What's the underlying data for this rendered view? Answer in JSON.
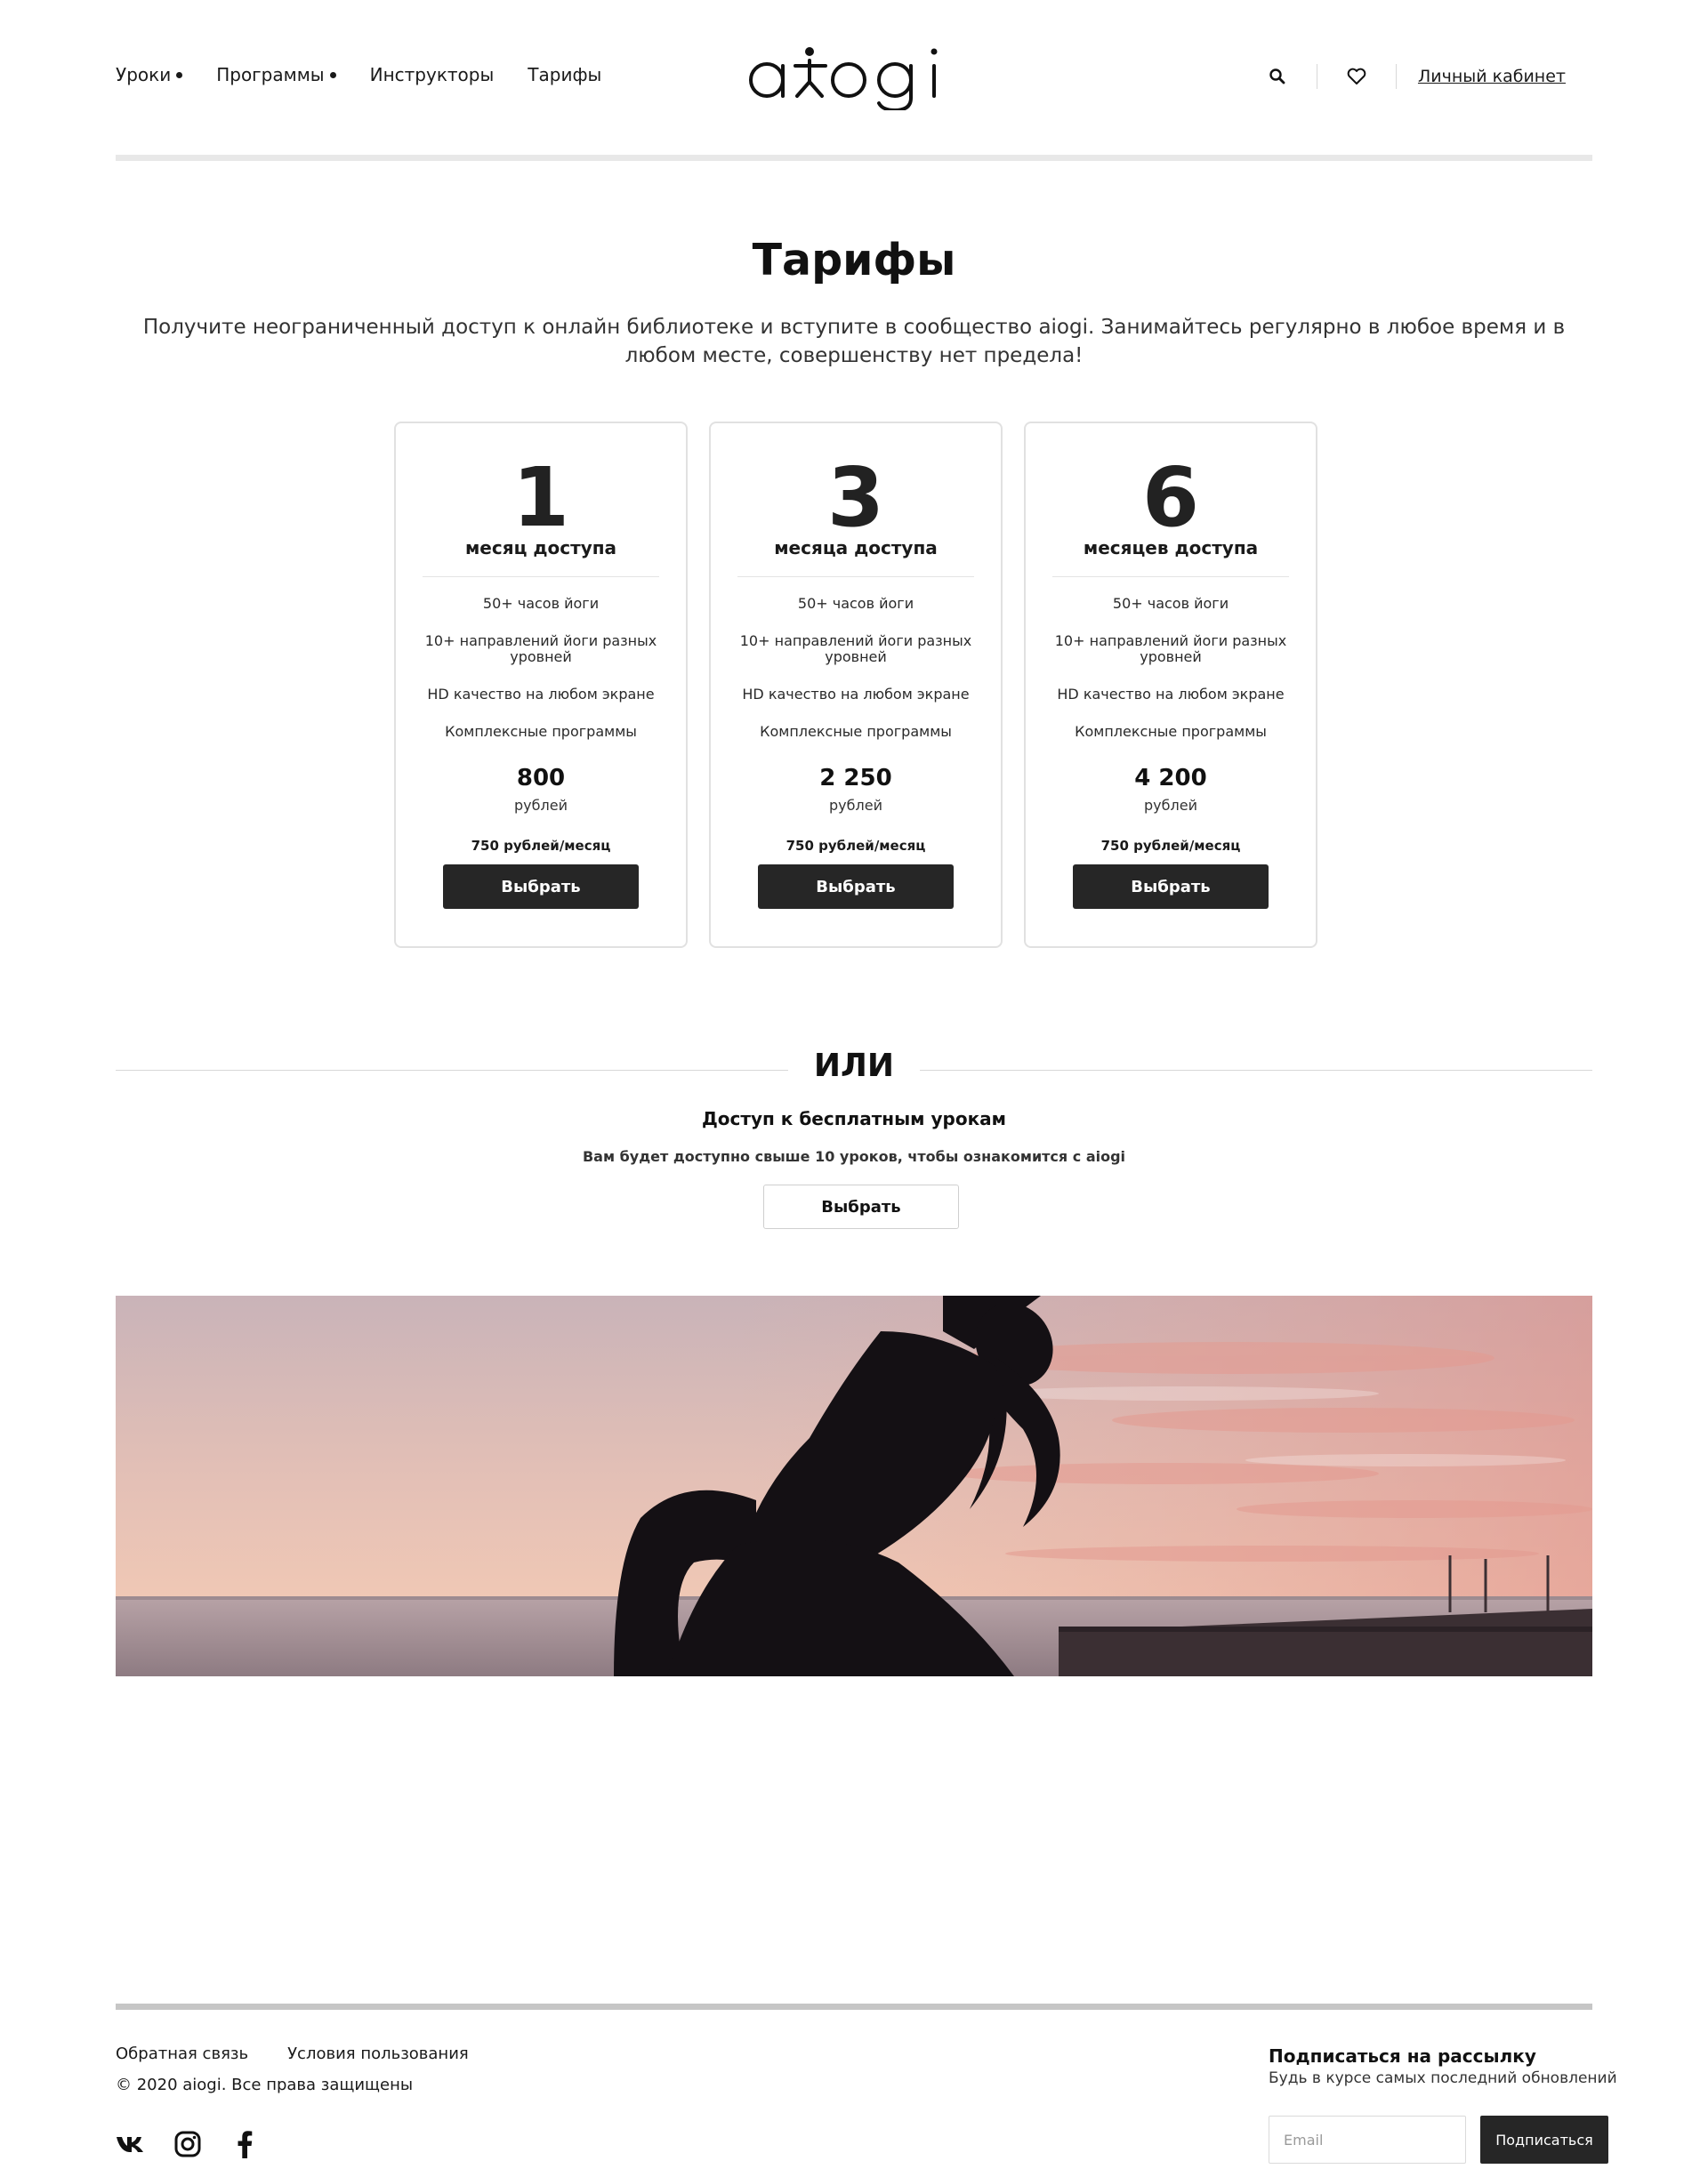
{
  "header": {
    "nav": [
      {
        "label": "Уроки",
        "has_dropdown": true
      },
      {
        "label": "Программы",
        "has_dropdown": true
      },
      {
        "label": "Инструкторы",
        "has_dropdown": false
      },
      {
        "label": "Тарифы",
        "has_dropdown": false
      }
    ],
    "logo_text": "aiogi",
    "account_label": "Личный кабинет",
    "icons": [
      "search-icon",
      "heart-icon"
    ]
  },
  "main": {
    "title": "Тарифы",
    "subtitle": "Получите неограниченный доступ к онлайн библиотеке и вступите в сообщество aiogi. Занимайтесь регулярно в любое время и в любом месте, совершенству нет предела!",
    "plans": [
      {
        "months": "1",
        "unit": "месяц доступа",
        "features": [
          "50+ часов йоги",
          "10+ направлений йоги разных уровней",
          "HD качество на любом экране",
          "Комплексные программы"
        ],
        "price": "800",
        "currency": "рублей",
        "monthly": "750 рублей/месяц",
        "button": "Выбрать"
      },
      {
        "months": "3",
        "unit": "месяца доступа",
        "features": [
          "50+ часов йоги",
          "10+ направлений йоги разных уровней",
          "HD качество на любом экране",
          "Комплексные программы"
        ],
        "price": "2 250",
        "currency": "рублей",
        "monthly": "750 рублей/месяц",
        "button": "Выбрать"
      },
      {
        "months": "6",
        "unit": "месяцев доступа",
        "features": [
          "50+ часов йоги",
          "10+ направлений йоги разных уровней",
          "HD качество на любом экране",
          "Комплексные программы"
        ],
        "price": "4 200",
        "currency": "рублей",
        "monthly": "750 рублей/месяц",
        "button": "Выбрать"
      }
    ],
    "or_text": "ИЛИ",
    "free": {
      "title": "Доступ к бесплатным урокам",
      "description": "Вам будет доступно свыше 10 уроков, чтобы ознакомится с aiogi",
      "button": "Выбрать"
    }
  },
  "footer": {
    "links": [
      "Обратная связь",
      "Условия пользования"
    ],
    "copyright": "© 2020 aiogi. Все права защищены",
    "socials": [
      "vk-icon",
      "instagram-icon",
      "facebook-icon"
    ],
    "subscribe": {
      "title": "Подписаться на рассылку",
      "subtitle": "Будь в курсе самых последний обновлений",
      "placeholder": "Email",
      "button": "Подписаться"
    }
  },
  "colors": {
    "dark_button": "#262626",
    "border": "#e1e1e1",
    "text": "#1a1a1a"
  }
}
